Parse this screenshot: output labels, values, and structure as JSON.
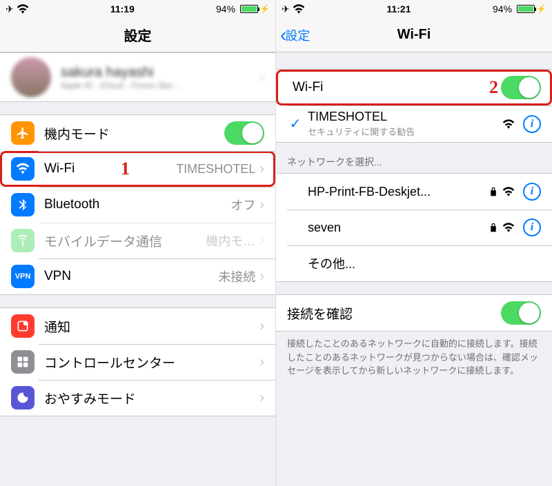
{
  "left": {
    "status": {
      "time": "11:19",
      "battery": "94%"
    },
    "nav_title": "設定",
    "profile": {
      "name": "sakura hayashi",
      "sub": "Apple ID · iCloud · iTunes Stor…"
    },
    "rows": {
      "airplane": {
        "label": "機内モード"
      },
      "wifi": {
        "label": "Wi-Fi",
        "value": "TIMESHOTEL"
      },
      "bluetooth": {
        "label": "Bluetooth",
        "value": "オフ"
      },
      "cellular": {
        "label": "モバイルデータ通信",
        "value": "機内モ…"
      },
      "vpn": {
        "label": "VPN",
        "value": "未接続"
      },
      "notifications": {
        "label": "通知"
      },
      "control_center": {
        "label": "コントロールセンター"
      },
      "dnd": {
        "label": "おやすみモード"
      }
    },
    "annotation": "1"
  },
  "right": {
    "status": {
      "time": "11:21",
      "battery": "94%"
    },
    "nav_back": "設定",
    "nav_title": "Wi-Fi",
    "wifi_toggle_label": "Wi-Fi",
    "connected": {
      "ssid": "TIMESHOTEL",
      "security_note": "セキュリティに関する勧告"
    },
    "choose_header": "ネットワークを選択...",
    "networks": [
      {
        "ssid": "HP-Print-FB-Deskjet...",
        "locked": true
      },
      {
        "ssid": "seven",
        "locked": true
      }
    ],
    "other": "その他...",
    "ask_to_join": "接続を確認",
    "footer": "接続したことのあるネットワークに自動的に接続します。接続したことのあるネットワークが見つからない場合は、確認メッセージを表示してから新しいネットワークに接続します。",
    "annotation": "2"
  }
}
